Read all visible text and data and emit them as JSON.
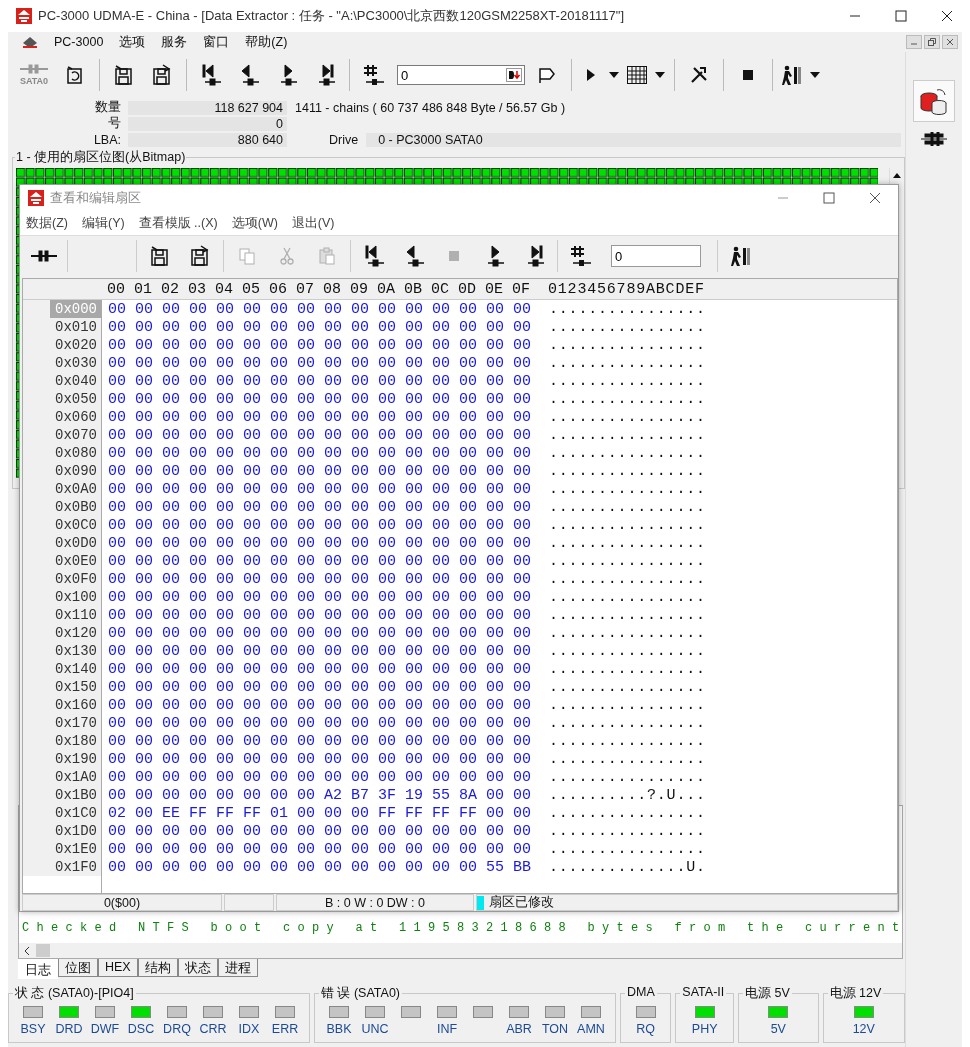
{
  "window": {
    "title": "PC-3000 UDMA-E - China - [Data Extractor : 任务 - \"A:\\PC3000\\北京西数120GSM2258XT-20181117\"]"
  },
  "menu": [
    "PC-3000",
    "选项",
    "服务",
    "窗口",
    "帮助(Z)"
  ],
  "toolbar": {
    "device_label": "SATA0",
    "input_value": "0"
  },
  "info": {
    "count_label": "数量",
    "count_value": "118 627 904",
    "chains": "1411 - chains  ( 60 737 486 848 Byte /  56.57 Gb )",
    "number_label": "号",
    "number_value": "0",
    "lba_label": "LBA:",
    "lba_value": "880 640",
    "drive_label": "Drive",
    "drive_value": "0 - PC3000 SATA0"
  },
  "bitmap_panel": {
    "title": "1 - 使用的扇区位图(从Bitmap)"
  },
  "child_window": {
    "title": "查看和编辑扇区",
    "menu": [
      "数据(Z)",
      "编辑(Y)",
      "查看模版 ..(X)",
      "选项(W)",
      "退出(V)"
    ],
    "toolbar": [
      {
        "disabled": false
      },
      {
        "disabled": false
      },
      {
        "disabled": false
      },
      {
        "disabled": true
      },
      {
        "disabled": true
      },
      {
        "disabled": true
      },
      {
        "disabled": false
      },
      {
        "disabled": false
      },
      {
        "disabled": true
      },
      {
        "disabled": false
      },
      {
        "disabled": false
      },
      {
        "disabled": false
      },
      {
        "disabled": false
      }
    ],
    "goto_value": "0",
    "hex_header": {
      "bytes": "00 01 02 03 04 05 06 07 08 09 0A 0B 0C 0D 0E 0F",
      "ascii": "0123456789ABCDEF"
    },
    "rows": [
      {
        "offset": "0x000",
        "selected": true,
        "bytes": "00 00 00 00 00 00 00 00 00 00 00 00 00 00 00 00",
        "ascii": "................"
      },
      {
        "offset": "0x010",
        "selected": false,
        "bytes": "00 00 00 00 00 00 00 00 00 00 00 00 00 00 00 00",
        "ascii": "................"
      },
      {
        "offset": "0x020",
        "selected": false,
        "bytes": "00 00 00 00 00 00 00 00 00 00 00 00 00 00 00 00",
        "ascii": "................"
      },
      {
        "offset": "0x030",
        "selected": false,
        "bytes": "00 00 00 00 00 00 00 00 00 00 00 00 00 00 00 00",
        "ascii": "................"
      },
      {
        "offset": "0x040",
        "selected": false,
        "bytes": "00 00 00 00 00 00 00 00 00 00 00 00 00 00 00 00",
        "ascii": "................"
      },
      {
        "offset": "0x050",
        "selected": false,
        "bytes": "00 00 00 00 00 00 00 00 00 00 00 00 00 00 00 00",
        "ascii": "................"
      },
      {
        "offset": "0x060",
        "selected": false,
        "bytes": "00 00 00 00 00 00 00 00 00 00 00 00 00 00 00 00",
        "ascii": "................"
      },
      {
        "offset": "0x070",
        "selected": false,
        "bytes": "00 00 00 00 00 00 00 00 00 00 00 00 00 00 00 00",
        "ascii": "................"
      },
      {
        "offset": "0x080",
        "selected": false,
        "bytes": "00 00 00 00 00 00 00 00 00 00 00 00 00 00 00 00",
        "ascii": "................"
      },
      {
        "offset": "0x090",
        "selected": false,
        "bytes": "00 00 00 00 00 00 00 00 00 00 00 00 00 00 00 00",
        "ascii": "................"
      },
      {
        "offset": "0x0A0",
        "selected": false,
        "bytes": "00 00 00 00 00 00 00 00 00 00 00 00 00 00 00 00",
        "ascii": "................"
      },
      {
        "offset": "0x0B0",
        "selected": false,
        "bytes": "00 00 00 00 00 00 00 00 00 00 00 00 00 00 00 00",
        "ascii": "................"
      },
      {
        "offset": "0x0C0",
        "selected": false,
        "bytes": "00 00 00 00 00 00 00 00 00 00 00 00 00 00 00 00",
        "ascii": "................"
      },
      {
        "offset": "0x0D0",
        "selected": false,
        "bytes": "00 00 00 00 00 00 00 00 00 00 00 00 00 00 00 00",
        "ascii": "................"
      },
      {
        "offset": "0x0E0",
        "selected": false,
        "bytes": "00 00 00 00 00 00 00 00 00 00 00 00 00 00 00 00",
        "ascii": "................"
      },
      {
        "offset": "0x0F0",
        "selected": false,
        "bytes": "00 00 00 00 00 00 00 00 00 00 00 00 00 00 00 00",
        "ascii": "................"
      },
      {
        "offset": "0x100",
        "selected": false,
        "bytes": "00 00 00 00 00 00 00 00 00 00 00 00 00 00 00 00",
        "ascii": "................"
      },
      {
        "offset": "0x110",
        "selected": false,
        "bytes": "00 00 00 00 00 00 00 00 00 00 00 00 00 00 00 00",
        "ascii": "................"
      },
      {
        "offset": "0x120",
        "selected": false,
        "bytes": "00 00 00 00 00 00 00 00 00 00 00 00 00 00 00 00",
        "ascii": "................"
      },
      {
        "offset": "0x130",
        "selected": false,
        "bytes": "00 00 00 00 00 00 00 00 00 00 00 00 00 00 00 00",
        "ascii": "................"
      },
      {
        "offset": "0x140",
        "selected": false,
        "bytes": "00 00 00 00 00 00 00 00 00 00 00 00 00 00 00 00",
        "ascii": "................"
      },
      {
        "offset": "0x150",
        "selected": false,
        "bytes": "00 00 00 00 00 00 00 00 00 00 00 00 00 00 00 00",
        "ascii": "................"
      },
      {
        "offset": "0x160",
        "selected": false,
        "bytes": "00 00 00 00 00 00 00 00 00 00 00 00 00 00 00 00",
        "ascii": "................"
      },
      {
        "offset": "0x170",
        "selected": false,
        "bytes": "00 00 00 00 00 00 00 00 00 00 00 00 00 00 00 00",
        "ascii": "................"
      },
      {
        "offset": "0x180",
        "selected": false,
        "bytes": "00 00 00 00 00 00 00 00 00 00 00 00 00 00 00 00",
        "ascii": "................"
      },
      {
        "offset": "0x190",
        "selected": false,
        "bytes": "00 00 00 00 00 00 00 00 00 00 00 00 00 00 00 00",
        "ascii": "................"
      },
      {
        "offset": "0x1A0",
        "selected": false,
        "bytes": "00 00 00 00 00 00 00 00 00 00 00 00 00 00 00 00",
        "ascii": "................"
      },
      {
        "offset": "0x1B0",
        "selected": false,
        "bytes": "00 00 00 00 00 00 00 00 A2 B7 3F 19 55 8A 00 00",
        "ascii": "..........?.U..."
      },
      {
        "offset": "0x1C0",
        "selected": false,
        "bytes": "02 00 EE FF FF FF 01 00 00 00 FF FF FF FF 00 00",
        "ascii": "................"
      },
      {
        "offset": "0x1D0",
        "selected": false,
        "bytes": "00 00 00 00 00 00 00 00 00 00 00 00 00 00 00 00",
        "ascii": "................"
      },
      {
        "offset": "0x1E0",
        "selected": false,
        "bytes": "00 00 00 00 00 00 00 00 00 00 00 00 00 00 00 00",
        "ascii": "................"
      },
      {
        "offset": "0x1F0",
        "selected": false,
        "bytes": "00 00 00 00 00 00 00 00 00 00 00 00 00 00 55 BB",
        "ascii": "..............U."
      }
    ],
    "status": {
      "position": "0($00)",
      "counters": "B : 0 W : 0 DW : 0",
      "modified": true,
      "modified_text": "扇区已修改"
    }
  },
  "log": {
    "line": "Checked NTFS boot copy at 119583218688 bytes from the current"
  },
  "tabs": [
    {
      "label": "日志",
      "selected": true
    },
    {
      "label": "位图",
      "selected": false
    },
    {
      "label": "HEX",
      "selected": false
    },
    {
      "label": "结构",
      "selected": false
    },
    {
      "label": "状态",
      "selected": false
    },
    {
      "label": "进程",
      "selected": false
    }
  ],
  "status_panel": [
    {
      "title": "状 态 (SATA0)-[PIO4]",
      "leds": [
        {
          "label": "BSY",
          "on": false
        },
        {
          "label": "DRD",
          "on": true
        },
        {
          "label": "DWF",
          "on": false
        },
        {
          "label": "DSC",
          "on": true
        },
        {
          "label": "DRQ",
          "on": false
        },
        {
          "label": "CRR",
          "on": false
        },
        {
          "label": "IDX",
          "on": false
        },
        {
          "label": "ERR",
          "on": false
        }
      ]
    },
    {
      "title": "错 误 (SATA0)",
      "leds": [
        {
          "label": "BBK",
          "on": false
        },
        {
          "label": "UNC",
          "on": false
        },
        {
          "on": false
        },
        {
          "label": "INF",
          "on": false
        },
        {
          "on": false
        },
        {
          "label": "ABR",
          "on": false
        },
        {
          "label": "TON",
          "on": false
        },
        {
          "label": "AMN",
          "on": false
        }
      ]
    },
    {
      "title": "DMA",
      "leds": [
        {
          "label": "RQ",
          "on": false
        }
      ]
    },
    {
      "title": "SATA-II",
      "leds": [
        {
          "label": "PHY",
          "on": true
        }
      ]
    },
    {
      "title": "电源 5V",
      "leds": [
        {
          "label": "5V",
          "on": true
        }
      ]
    },
    {
      "title": "电源 12V",
      "leds": [
        {
          "label": "12V",
          "on": true
        }
      ]
    }
  ]
}
